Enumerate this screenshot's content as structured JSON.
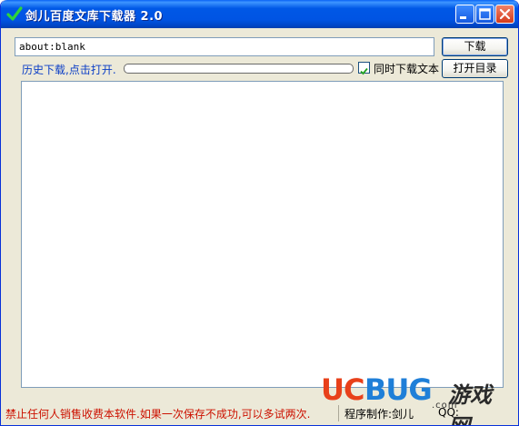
{
  "window": {
    "title": "剑儿百度文库下载器 2.0",
    "icon": "checkmark-icon",
    "controls": [
      "minimize-icon",
      "maximize-icon",
      "close-icon"
    ]
  },
  "toolbar": {
    "url_value": "about:blank",
    "download_label": "下载",
    "open_dir_label": "打开目录"
  },
  "options": {
    "history_link": "历史下载,点击打开.",
    "progress": 0,
    "sync_text_checked": true,
    "sync_text_label": "同时下载文本"
  },
  "status": {
    "warning": "禁止任何人销售收费本软件.如果一次保存不成功,可以多试两次.",
    "author": "程序制作:剑儿",
    "qq": "QQ:"
  },
  "watermark": {
    "part1": "UC",
    "part2": "BUG",
    "chinese": "游戏网",
    "domain": ".com"
  },
  "colors": {
    "titlebar": "#0054e3",
    "window_bg": "#ece9d8",
    "warning_text": "#cc1100",
    "link_text": "#0b3ec6",
    "watermark_uc": "#e8401a",
    "watermark_bug": "#1f7fd8"
  }
}
